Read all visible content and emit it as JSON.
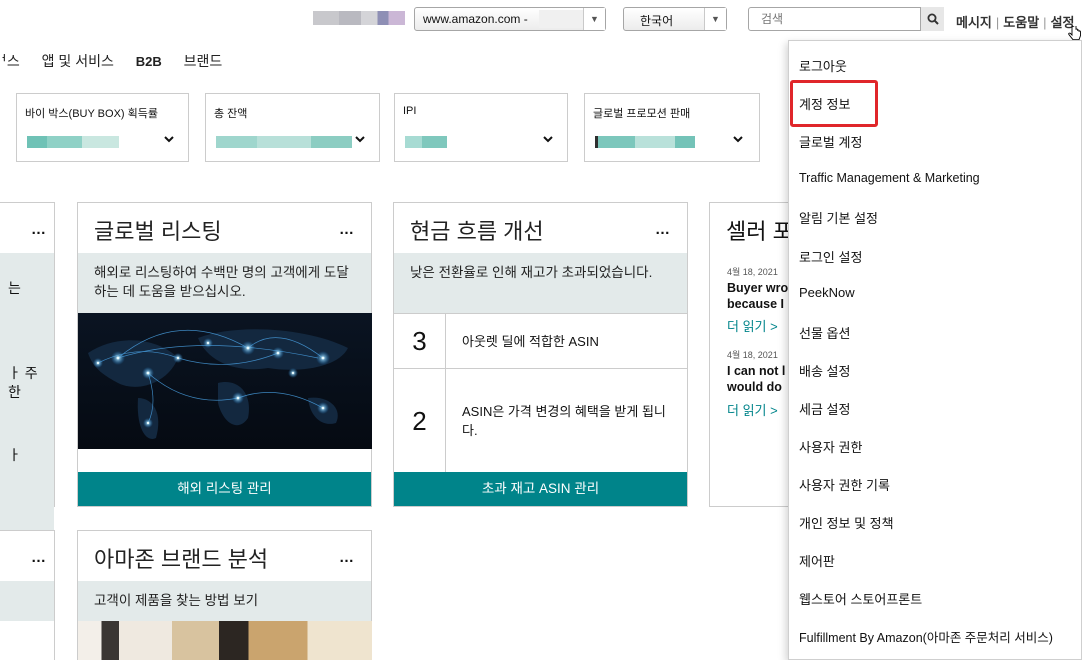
{
  "topbar": {
    "marketplace": "www.amazon.com -",
    "language": "한국어",
    "search_placeholder": "검색",
    "messages": "메시지",
    "help": "도움말",
    "settings": "설정",
    "sep": "|"
  },
  "nav": {
    "items": [
      "ᅥ스",
      "앱 및 서비스",
      "B2B",
      "브랜드"
    ]
  },
  "metrics": [
    {
      "label": "바이 박스(BUY BOX) 획득률"
    },
    {
      "label": "총 잔액"
    },
    {
      "label": "IPI"
    },
    {
      "label": "글로벌 프로모션 판매"
    }
  ],
  "left_partial": {
    "dots": "…",
    "text1": "는",
    "text2": "ㅏ 주",
    "text3": "한",
    "text4": "ㅏ",
    "dots2": "…"
  },
  "global_listing": {
    "title": "글로벌 리스팅",
    "dots": "…",
    "description": "해외로 리스팅하여 수백만 명의 고객에게 도달하는 데 도움을 받으십시오.",
    "button": "해외 리스팅 관리"
  },
  "cashflow": {
    "title": "현금 흐름 개선",
    "dots": "…",
    "description": "낮은 전환율로 인해 재고가 초과되었습니다.",
    "rows": [
      {
        "num": "3",
        "text": "아웃렛 딜에 적합한 ASIN"
      },
      {
        "num": "2",
        "text": "ASIN은 가격 변경의 혜택을 받게 됩니다."
      }
    ],
    "button": "초과 재고 ASIN 관리"
  },
  "seller_forum": {
    "title": "셀러 포",
    "posts": [
      {
        "date": "4월 18, 2021",
        "line1": "Buyer wro",
        "line2": "because I",
        "more": "더 읽기 >"
      },
      {
        "date": "4월 18, 2021",
        "line1": "I can not l",
        "line2": "would do",
        "more": "더 읽기 >"
      }
    ]
  },
  "brand_analytics": {
    "title": "아마존 브랜드 분석",
    "dots": "…",
    "description": "고객이 제품을 찾는 방법 보기"
  },
  "settings_menu": {
    "items": [
      "로그아웃",
      "계정 정보",
      "글로벌 계정",
      "Traffic Management & Marketing",
      "알림 기본 설정",
      "로그인 설정",
      "PeekNow",
      "선물 옵션",
      "배송 설정",
      "세금 설정",
      "사용자 권한",
      "사용자 권한 기록",
      "개인 정보 및 정책",
      "제어판",
      "웹스토어 스토어프론트",
      "Fulfillment By Amazon(아마존 주문처리 서비스)"
    ]
  },
  "colors": {
    "accent": "#00848a",
    "description_bg": "#e3eaea",
    "highlight": "#e0262a"
  }
}
